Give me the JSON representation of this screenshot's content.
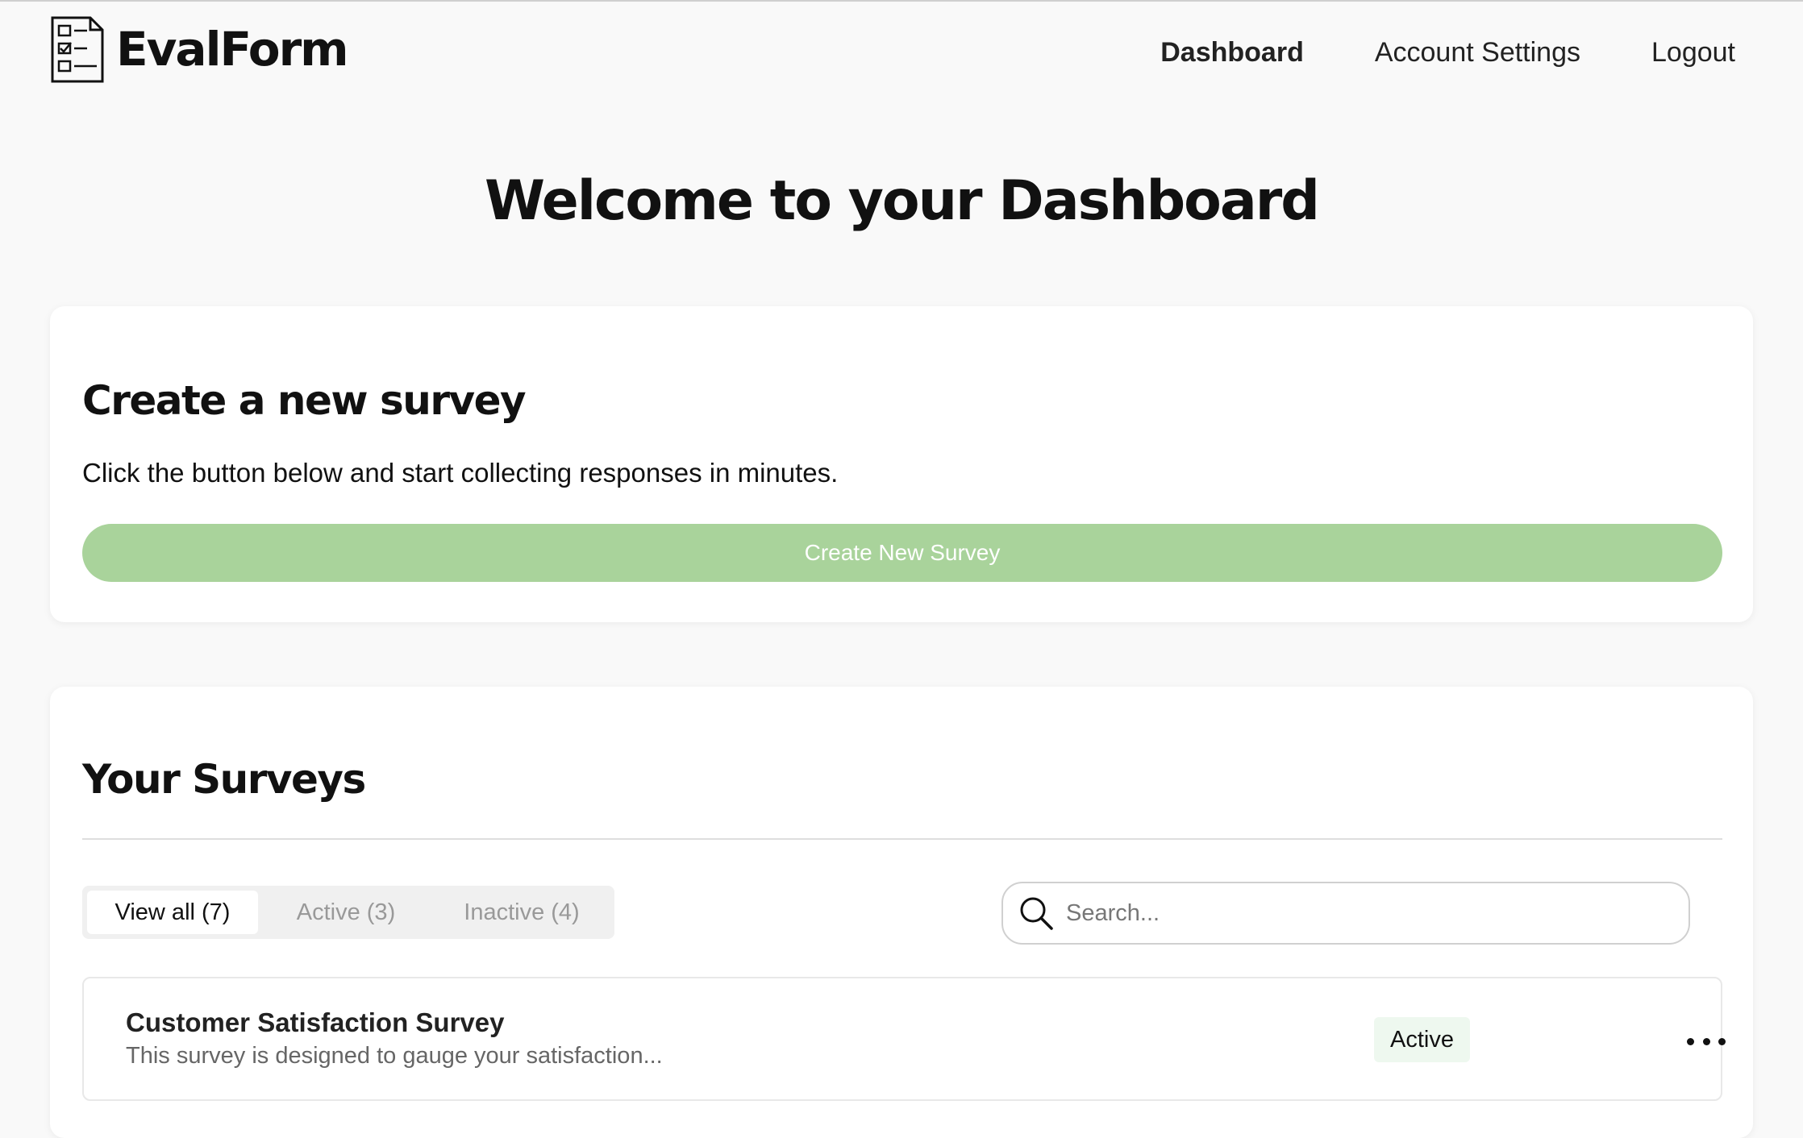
{
  "brand": {
    "name": "EvalForm"
  },
  "nav": {
    "dashboard": "Dashboard",
    "account_settings": "Account Settings",
    "logout": "Logout"
  },
  "page_title": "Welcome to your Dashboard",
  "create_card": {
    "heading": "Create a new survey",
    "description": "Click the button below and start collecting responses in minutes.",
    "button_label": "Create New Survey"
  },
  "surveys_card": {
    "heading": "Your Surveys",
    "tabs": [
      {
        "label": "View all (7)",
        "selected": true
      },
      {
        "label": "Active (3)",
        "selected": false
      },
      {
        "label": "Inactive (4)",
        "selected": false
      }
    ],
    "search": {
      "placeholder": "Search...",
      "value": ""
    },
    "items": [
      {
        "title": "Customer Satisfaction Survey",
        "description": "This survey is designed to gauge your satisfaction...",
        "status": "Active"
      }
    ]
  },
  "colors": {
    "accent": "#a9d39b",
    "background": "#f9f9f9",
    "badge_bg": "#eef8ef"
  },
  "icons": [
    "checklist-logo-icon",
    "search-icon",
    "more-options-icon"
  ]
}
